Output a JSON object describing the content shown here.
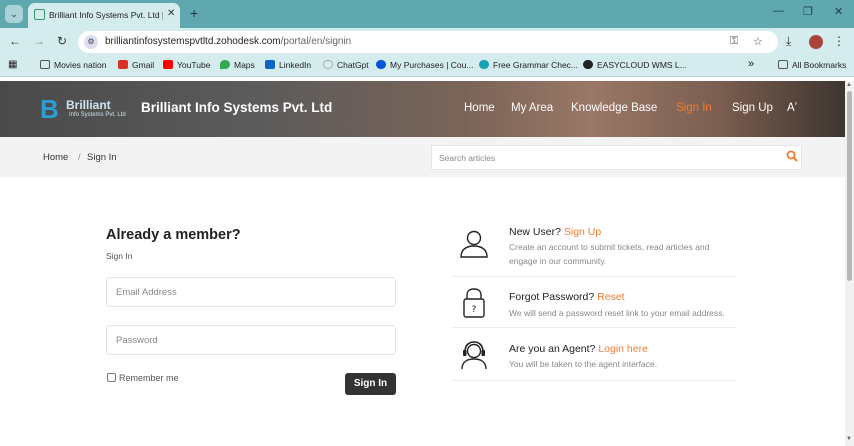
{
  "browser": {
    "tab_title": "Brilliant Info Systems Pvt. Ltd | S",
    "tab_close": "✕",
    "new_tab": "+",
    "tab_list": "⌄",
    "window": {
      "minimize": "—",
      "restore": "❐",
      "close": "✕"
    },
    "nav": {
      "back": "←",
      "forward": "→",
      "reload": "↻"
    },
    "url_host": "brilliantinfosystemspvtltd.zohodesk.com",
    "url_path": "/portal/en/signin",
    "bookmarks": [
      {
        "label": "Movies nation",
        "icon": "folder-icon",
        "color": "#555555"
      },
      {
        "label": "Gmail",
        "icon": "gmail-icon",
        "color": "#d93025"
      },
      {
        "label": "YouTube",
        "icon": "youtube-icon",
        "color": "#ff0000"
      },
      {
        "label": "Maps",
        "icon": "maps-icon",
        "color": "#34a853"
      },
      {
        "label": "LinkedIn",
        "icon": "linkedin-icon",
        "color": "#0a66c2"
      },
      {
        "label": "ChatGpt",
        "icon": "chatgpt-icon",
        "color": "#cccccc"
      },
      {
        "label": "My Purchases | Cou...",
        "icon": "coursera-icon",
        "color": "#0056d2"
      },
      {
        "label": "Free Grammar Chec...",
        "icon": "grammar-icon",
        "color": "#15a3b5"
      },
      {
        "label": "EASYCLOUD WMS L...",
        "icon": "easycloud-icon",
        "color": "#222222"
      }
    ],
    "more_bookmarks": "»",
    "all_bookmarks": "All Bookmarks"
  },
  "site": {
    "logo_text": "Brilliant",
    "logo_sub": "Info Systems Pvt. Ltd",
    "brand": "Brilliant Info Systems Pvt. Ltd",
    "nav": [
      "Home",
      "My Area",
      "Knowledge Base",
      "Sign In",
      "Sign Up"
    ],
    "font_size_toggle": "Aʼ",
    "accent": "#f07c32"
  },
  "breadcrumb": {
    "home": "Home",
    "sep": "/",
    "current": "Sign In"
  },
  "search": {
    "placeholder": "Search articles"
  },
  "login": {
    "title": "Already a member?",
    "subtitle": "Sign In",
    "email_placeholder": "Email Address",
    "password_placeholder": "Password",
    "remember": "Remember me",
    "button": "Sign In"
  },
  "side_items": [
    {
      "title": "New User?",
      "link": "Sign Up",
      "desc": "Create an account to submit tickets, read articles and engage in our community.",
      "icon": "user-icon"
    },
    {
      "title": "Forgot Password?",
      "link": "Reset",
      "desc": "We will send a password reset link to your email address.",
      "icon": "lock-icon"
    },
    {
      "title": "Are you an Agent?",
      "link": "Login here",
      "desc": "You will be taken to the agent interface.",
      "icon": "headset-icon"
    }
  ]
}
